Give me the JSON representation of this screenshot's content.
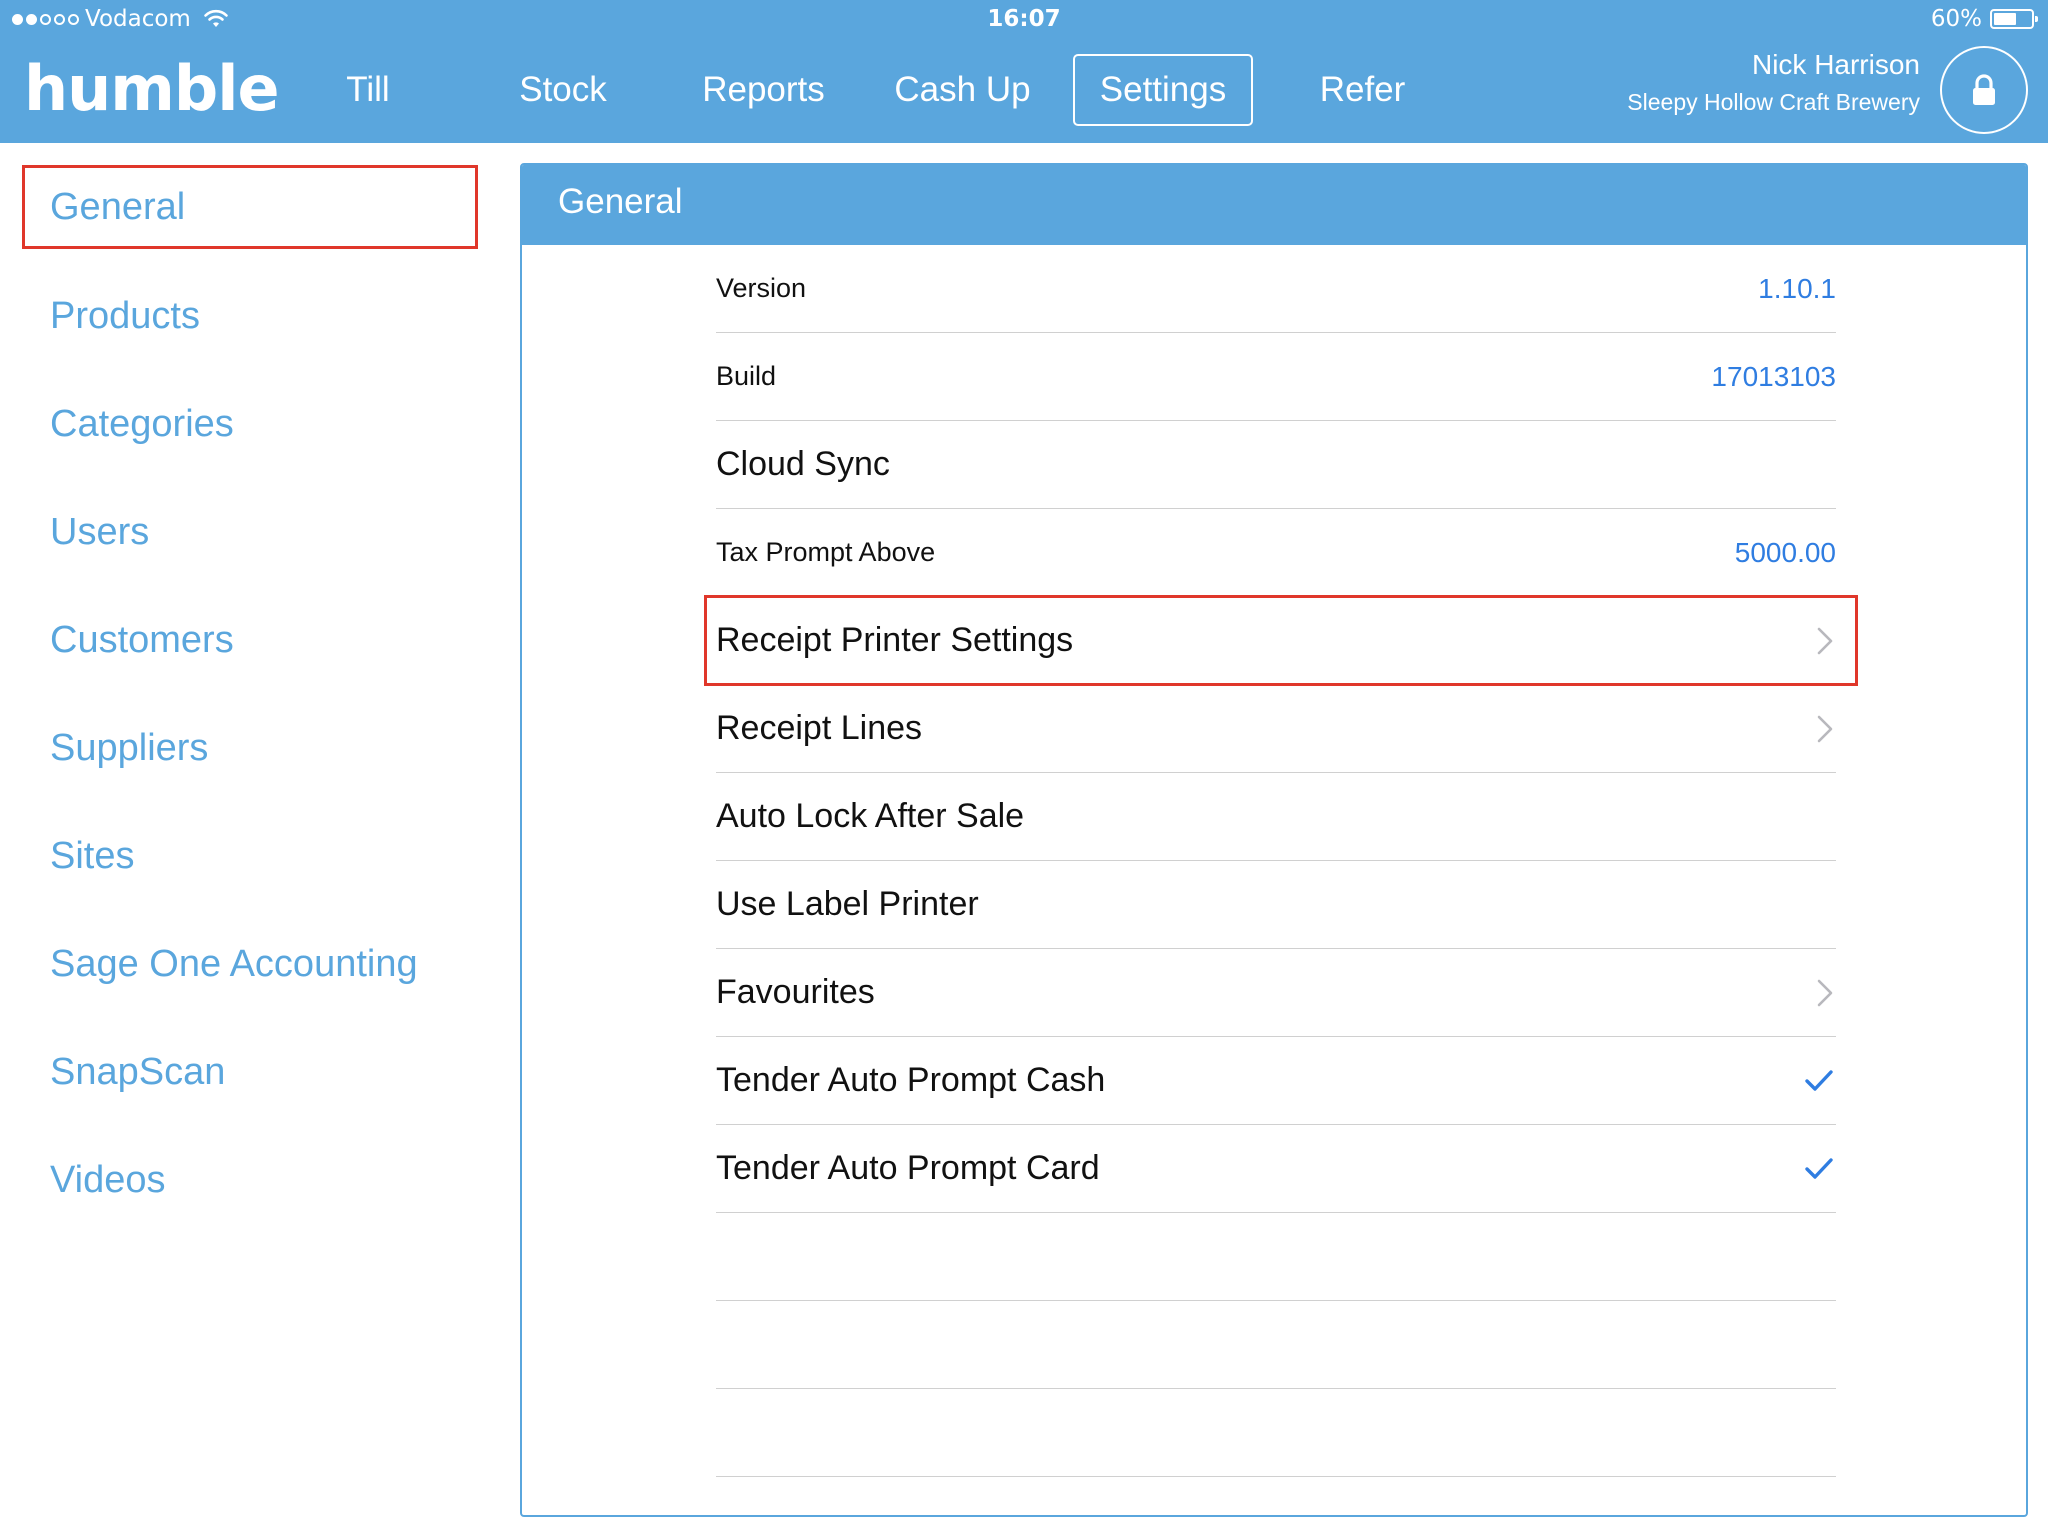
{
  "status_bar": {
    "carrier": "Vodacom",
    "time": "16:07",
    "battery": "60%",
    "battery_level": 0.6,
    "signal_bars": 2
  },
  "app": {
    "logo": "humble"
  },
  "nav": {
    "items": [
      {
        "label": "Till"
      },
      {
        "label": "Stock"
      },
      {
        "label": "Reports"
      },
      {
        "label": "Cash Up"
      },
      {
        "label": "Settings",
        "active": true
      },
      {
        "label": "Refer"
      }
    ]
  },
  "user": {
    "name": "Nick Harrison",
    "company": "Sleepy Hollow Craft Brewery"
  },
  "sidebar": {
    "items": [
      {
        "label": "General",
        "highlighted": true
      },
      {
        "label": "Products"
      },
      {
        "label": "Categories"
      },
      {
        "label": "Users"
      },
      {
        "label": "Customers"
      },
      {
        "label": "Suppliers"
      },
      {
        "label": "Sites"
      },
      {
        "label": "Sage One Accounting"
      },
      {
        "label": "SnapScan"
      },
      {
        "label": "Videos"
      }
    ]
  },
  "panel": {
    "title": "General",
    "rows": [
      {
        "label": "Version",
        "value": "1.10.1"
      },
      {
        "label": "Build",
        "value": "17013103"
      },
      {
        "label": "Cloud Sync"
      },
      {
        "label": "Tax Prompt Above",
        "value": "5000.00"
      },
      {
        "label": "Receipt Printer Settings",
        "accessory": "chevron",
        "highlighted": true
      },
      {
        "label": "Receipt Lines",
        "accessory": "chevron"
      },
      {
        "label": "Auto Lock After Sale"
      },
      {
        "label": "Use Label Printer"
      },
      {
        "label": "Favourites",
        "accessory": "chevron"
      },
      {
        "label": "Tender Auto Prompt Cash",
        "accessory": "checkmark"
      },
      {
        "label": "Tender Auto Prompt Card",
        "accessory": "checkmark"
      },
      {
        "label": ""
      },
      {
        "label": ""
      },
      {
        "label": ""
      }
    ]
  },
  "colors": {
    "brand_blue": "#5aa6dd",
    "value_blue": "#2f7de1",
    "highlight_red": "#e0372a"
  },
  "icons": {
    "wifi": "wifi-icon",
    "battery": "battery-icon",
    "lock": "lock-icon",
    "chevron": "chevron-right-icon",
    "checkmark": "checkmark-icon"
  }
}
